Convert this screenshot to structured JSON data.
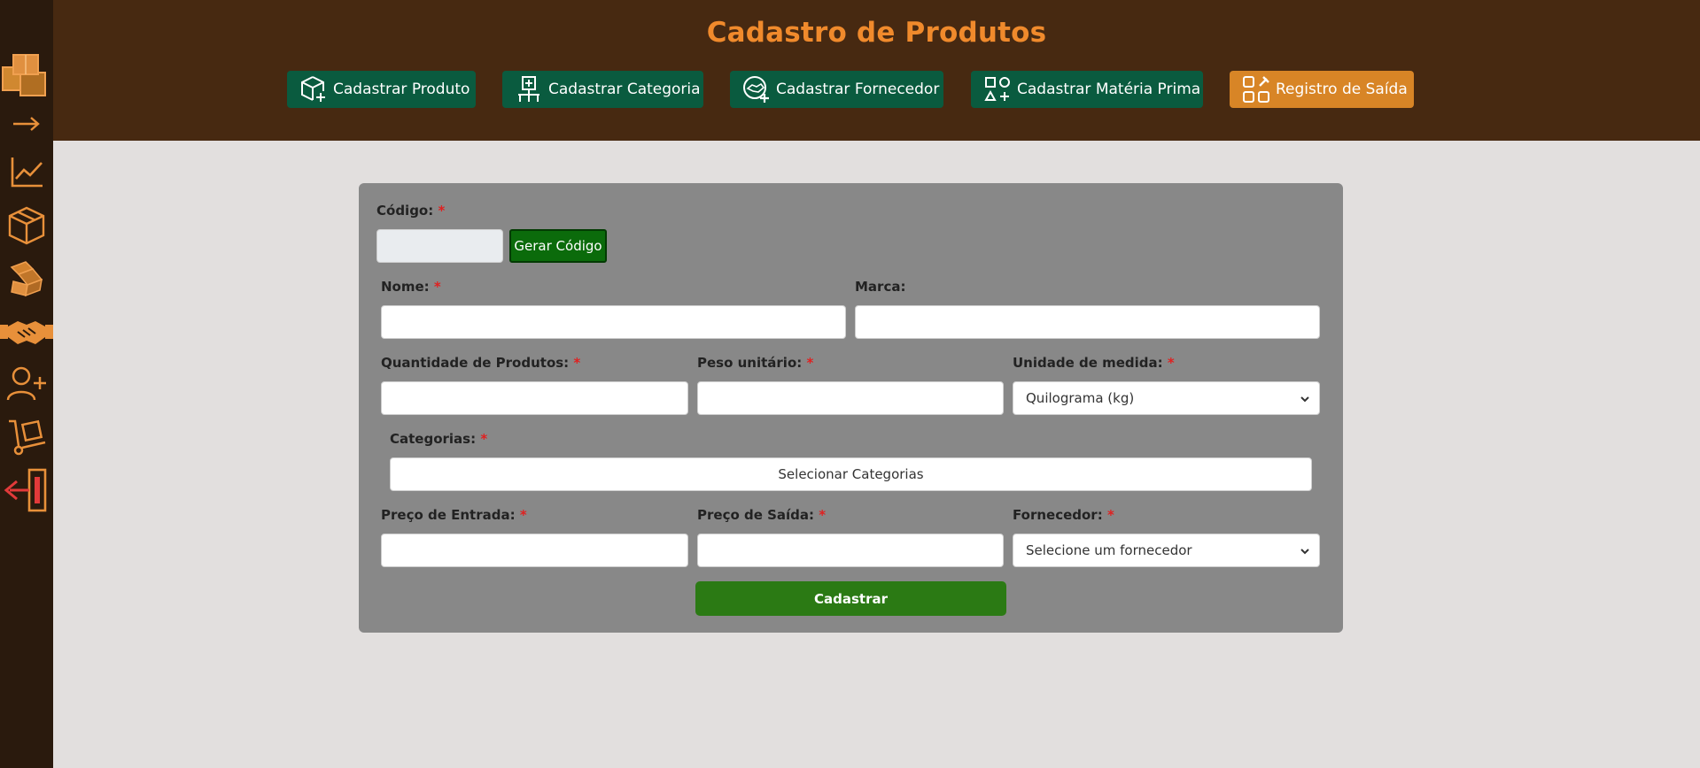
{
  "header": {
    "title": "Cadastro de Produtos",
    "nav": [
      {
        "label": "Cadastrar Produto",
        "icon": "box-plus-icon"
      },
      {
        "label": "Cadastrar Categoria",
        "icon": "category-tree-icon"
      },
      {
        "label": "Cadastrar Fornecedor",
        "icon": "supplier-handshake-icon"
      },
      {
        "label": "Cadastrar Matéria Prima",
        "icon": "shapes-icon"
      },
      {
        "label": "Registro de Saída",
        "icon": "exit-register-icon"
      }
    ]
  },
  "sidebar": {
    "items": [
      "boxes-logo-icon",
      "arrow-right-icon",
      "chart-line-icon",
      "box-icon",
      "boxes-icon",
      "handshake-icon",
      "user-plus-icon",
      "hand-truck-icon",
      "logout-icon"
    ]
  },
  "form": {
    "codigo_label": "Código:",
    "gerar_label": "Gerar Código",
    "nome_label": "Nome:",
    "marca_label": "Marca:",
    "quantidade_label": "Quantidade de Produtos:",
    "peso_label": "Peso unitário:",
    "unidade_label": "Unidade de medida:",
    "unidade_value": "Quilograma (kg)",
    "categorias_label": "Categorias:",
    "categorias_button": "Selecionar Categorias",
    "preco_entrada_label": "Preço de Entrada:",
    "preco_saida_label": "Preço de Saída:",
    "fornecedor_label": "Fornecedor:",
    "fornecedor_value": "Selecione um fornecedor",
    "submit_label": "Cadastrar",
    "required_mark": "*"
  },
  "colors": {
    "sidebar_bg": "#2a1a0d",
    "header_bg": "#472911",
    "accent_orange": "#f08a2c",
    "nav_green": "#0a5b3f",
    "nav_orange": "#d88526",
    "card_bg": "#888888",
    "submit_green": "#2b7a14",
    "page_bg": "#e2dfde"
  }
}
